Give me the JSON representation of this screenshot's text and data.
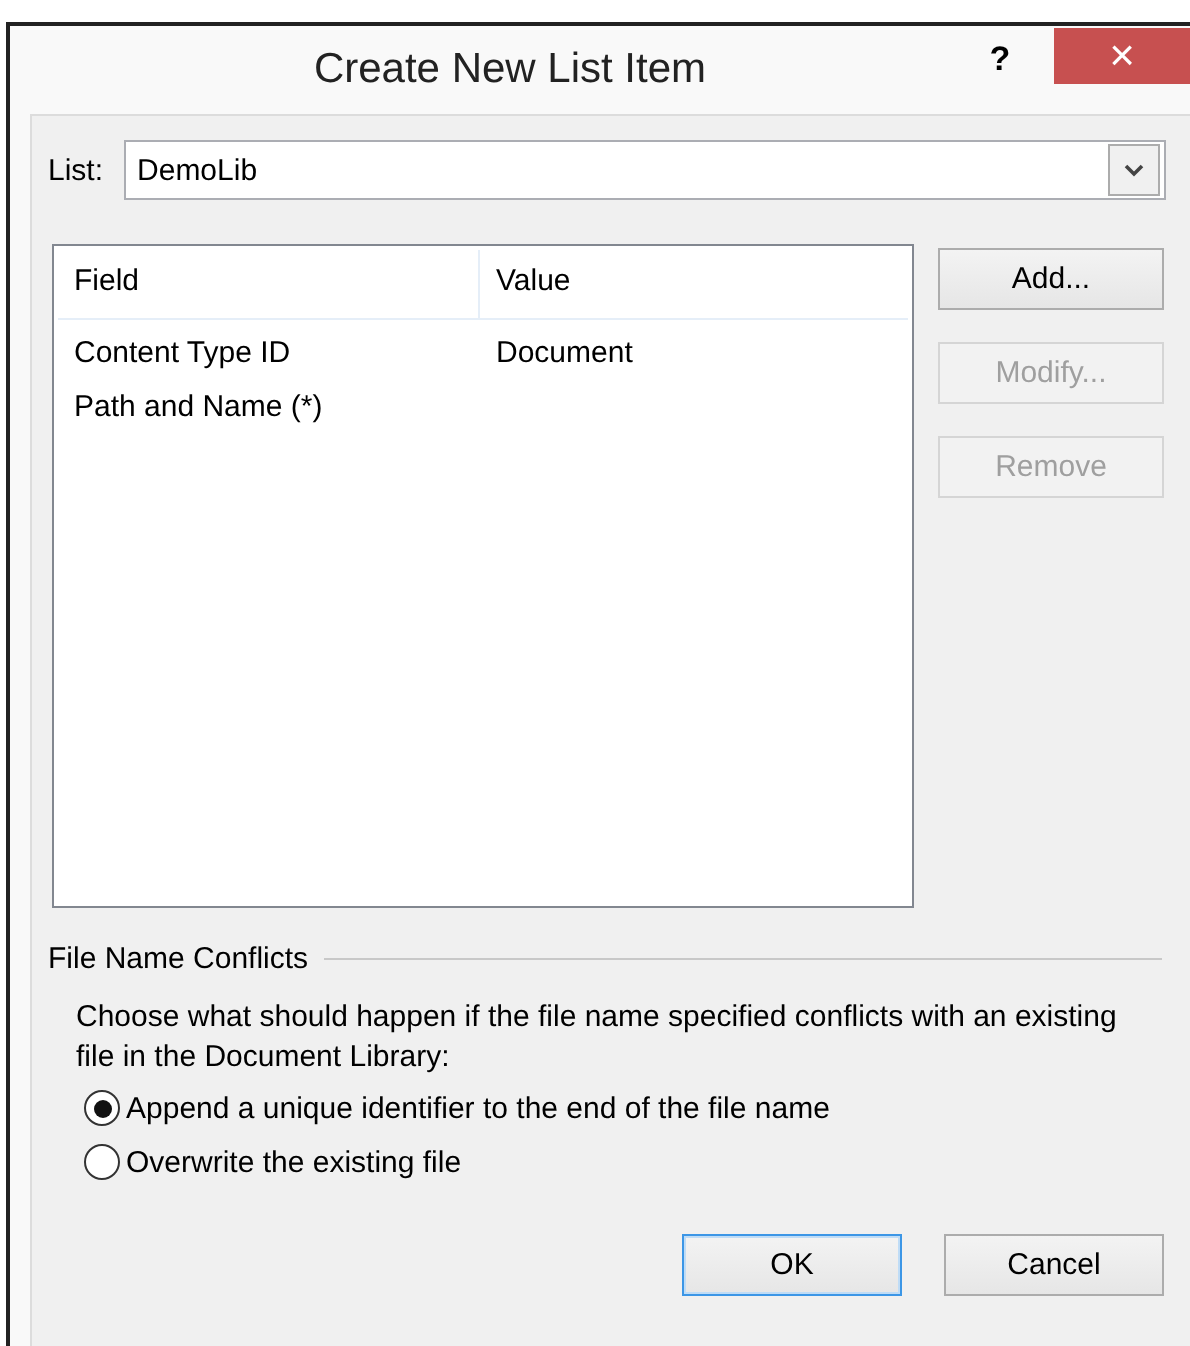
{
  "window": {
    "title": "Create New List Item",
    "help_button": "?",
    "close_button": "×"
  },
  "list": {
    "label": "List:",
    "value": "DemoLib"
  },
  "table": {
    "columns": [
      "Field",
      "Value"
    ],
    "rows": [
      {
        "field": "Content Type ID",
        "value": "Document"
      },
      {
        "field": "Path and Name (*)"
      }
    ]
  },
  "side_buttons": [
    {
      "label": "Add...",
      "disabled": false
    },
    {
      "label": "Modify...",
      "disabled": true
    },
    {
      "label": "Remove",
      "disabled": true
    }
  ],
  "conflicts": {
    "title": "File Name Conflicts",
    "description": "Choose what should happen if the file name specified conflicts with an existing file in the Document Library:",
    "options": [
      {
        "label": "Append a unique identifier to the end of the file name",
        "selected": true
      },
      {
        "label": "Overwrite the existing file",
        "selected": false
      }
    ]
  },
  "buttons": [
    {
      "label": "OK",
      "default": true
    },
    {
      "label": "Cancel",
      "default": false
    }
  ]
}
